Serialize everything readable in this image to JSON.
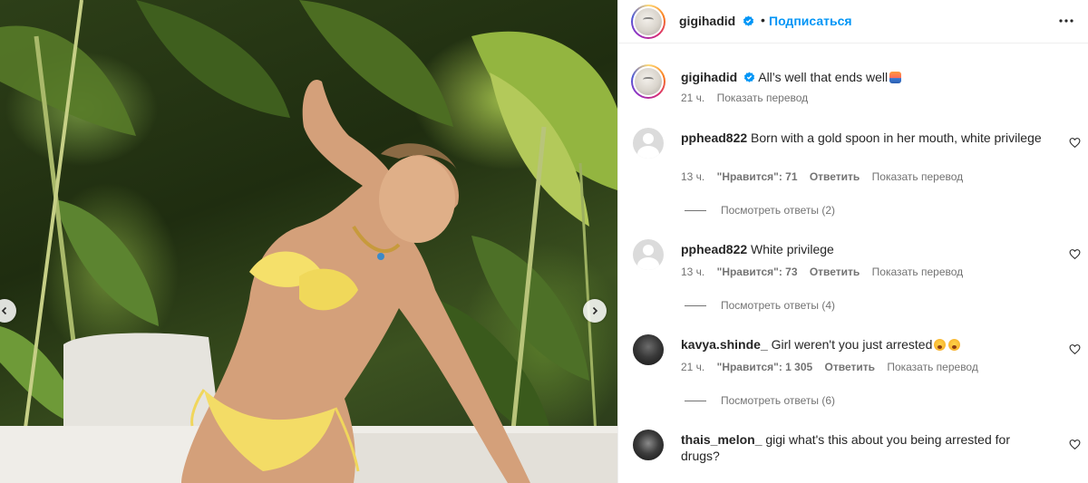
{
  "post": {
    "author": "gigihadid",
    "follow_label": "Подписаться",
    "separator": "•",
    "caption_text": "All’s well that ends well",
    "caption_time": "21 ч.",
    "caption_translate": "Показать перевод"
  },
  "icons": {
    "verified": "verified-badge-icon",
    "more": "more-options-icon",
    "heart": "heart-icon",
    "prev": "chevron-left-icon",
    "next": "chevron-right-icon",
    "emoji_sunrise": "sunrise-emoji",
    "emoji_cry": "crying-face-emoji"
  },
  "colors": {
    "accent": "#0095f6",
    "verified": "#0095f6",
    "secondary_text": "#737373"
  },
  "comments": [
    {
      "username": "pphead822",
      "text": "Born with a gold spoon in her mouth, white privilege",
      "time": "13 ч.",
      "likes": "\"Нравится\": 71",
      "reply": "Ответить",
      "translate": "Показать перевод",
      "replies": "Посмотреть ответы (2)"
    },
    {
      "username": "pphead822",
      "text": "White privilege",
      "time": "13 ч.",
      "likes": "\"Нравится\": 73",
      "reply": "Ответить",
      "translate": "Показать перевод",
      "replies": "Посмотреть ответы (4)"
    },
    {
      "username": "kavya.shinde_",
      "text": "Girl weren't you just arrested",
      "time": "21 ч.",
      "likes": "\"Нравится\": 1 305",
      "reply": "Ответить",
      "translate": "Показать перевод",
      "replies": "Посмотреть ответы (6)"
    },
    {
      "username": "thais_melon_",
      "text": "gigi what's this about you being arrested for drugs?"
    }
  ]
}
